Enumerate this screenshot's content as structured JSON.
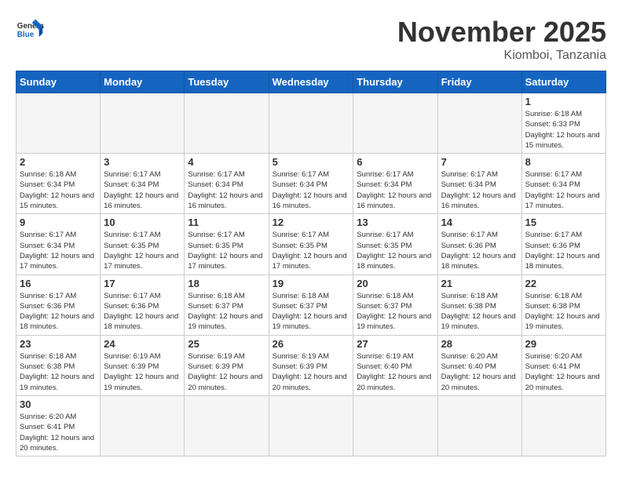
{
  "header": {
    "logo_general": "General",
    "logo_blue": "Blue",
    "month_title": "November 2025",
    "location": "Kiomboi, Tanzania"
  },
  "weekdays": [
    "Sunday",
    "Monday",
    "Tuesday",
    "Wednesday",
    "Thursday",
    "Friday",
    "Saturday"
  ],
  "weeks": [
    [
      {
        "day": "",
        "info": ""
      },
      {
        "day": "",
        "info": ""
      },
      {
        "day": "",
        "info": ""
      },
      {
        "day": "",
        "info": ""
      },
      {
        "day": "",
        "info": ""
      },
      {
        "day": "",
        "info": ""
      },
      {
        "day": "1",
        "info": "Sunrise: 6:18 AM\nSunset: 6:33 PM\nDaylight: 12 hours and 15 minutes."
      }
    ],
    [
      {
        "day": "2",
        "info": "Sunrise: 6:18 AM\nSunset: 6:34 PM\nDaylight: 12 hours and 15 minutes."
      },
      {
        "day": "3",
        "info": "Sunrise: 6:17 AM\nSunset: 6:34 PM\nDaylight: 12 hours and 16 minutes."
      },
      {
        "day": "4",
        "info": "Sunrise: 6:17 AM\nSunset: 6:34 PM\nDaylight: 12 hours and 16 minutes."
      },
      {
        "day": "5",
        "info": "Sunrise: 6:17 AM\nSunset: 6:34 PM\nDaylight: 12 hours and 16 minutes."
      },
      {
        "day": "6",
        "info": "Sunrise: 6:17 AM\nSunset: 6:34 PM\nDaylight: 12 hours and 16 minutes."
      },
      {
        "day": "7",
        "info": "Sunrise: 6:17 AM\nSunset: 6:34 PM\nDaylight: 12 hours and 16 minutes."
      },
      {
        "day": "8",
        "info": "Sunrise: 6:17 AM\nSunset: 6:34 PM\nDaylight: 12 hours and 17 minutes."
      }
    ],
    [
      {
        "day": "9",
        "info": "Sunrise: 6:17 AM\nSunset: 6:34 PM\nDaylight: 12 hours and 17 minutes."
      },
      {
        "day": "10",
        "info": "Sunrise: 6:17 AM\nSunset: 6:35 PM\nDaylight: 12 hours and 17 minutes."
      },
      {
        "day": "11",
        "info": "Sunrise: 6:17 AM\nSunset: 6:35 PM\nDaylight: 12 hours and 17 minutes."
      },
      {
        "day": "12",
        "info": "Sunrise: 6:17 AM\nSunset: 6:35 PM\nDaylight: 12 hours and 17 minutes."
      },
      {
        "day": "13",
        "info": "Sunrise: 6:17 AM\nSunset: 6:35 PM\nDaylight: 12 hours and 18 minutes."
      },
      {
        "day": "14",
        "info": "Sunrise: 6:17 AM\nSunset: 6:36 PM\nDaylight: 12 hours and 18 minutes."
      },
      {
        "day": "15",
        "info": "Sunrise: 6:17 AM\nSunset: 6:36 PM\nDaylight: 12 hours and 18 minutes."
      }
    ],
    [
      {
        "day": "16",
        "info": "Sunrise: 6:17 AM\nSunset: 6:36 PM\nDaylight: 12 hours and 18 minutes."
      },
      {
        "day": "17",
        "info": "Sunrise: 6:17 AM\nSunset: 6:36 PM\nDaylight: 12 hours and 18 minutes."
      },
      {
        "day": "18",
        "info": "Sunrise: 6:18 AM\nSunset: 6:37 PM\nDaylight: 12 hours and 19 minutes."
      },
      {
        "day": "19",
        "info": "Sunrise: 6:18 AM\nSunset: 6:37 PM\nDaylight: 12 hours and 19 minutes."
      },
      {
        "day": "20",
        "info": "Sunrise: 6:18 AM\nSunset: 6:37 PM\nDaylight: 12 hours and 19 minutes."
      },
      {
        "day": "21",
        "info": "Sunrise: 6:18 AM\nSunset: 6:38 PM\nDaylight: 12 hours and 19 minutes."
      },
      {
        "day": "22",
        "info": "Sunrise: 6:18 AM\nSunset: 6:38 PM\nDaylight: 12 hours and 19 minutes."
      }
    ],
    [
      {
        "day": "23",
        "info": "Sunrise: 6:18 AM\nSunset: 6:38 PM\nDaylight: 12 hours and 19 minutes."
      },
      {
        "day": "24",
        "info": "Sunrise: 6:19 AM\nSunset: 6:39 PM\nDaylight: 12 hours and 19 minutes."
      },
      {
        "day": "25",
        "info": "Sunrise: 6:19 AM\nSunset: 6:39 PM\nDaylight: 12 hours and 20 minutes."
      },
      {
        "day": "26",
        "info": "Sunrise: 6:19 AM\nSunset: 6:39 PM\nDaylight: 12 hours and 20 minutes."
      },
      {
        "day": "27",
        "info": "Sunrise: 6:19 AM\nSunset: 6:40 PM\nDaylight: 12 hours and 20 minutes."
      },
      {
        "day": "28",
        "info": "Sunrise: 6:20 AM\nSunset: 6:40 PM\nDaylight: 12 hours and 20 minutes."
      },
      {
        "day": "29",
        "info": "Sunrise: 6:20 AM\nSunset: 6:41 PM\nDaylight: 12 hours and 20 minutes."
      }
    ],
    [
      {
        "day": "30",
        "info": "Sunrise: 6:20 AM\nSunset: 6:41 PM\nDaylight: 12 hours and 20 minutes."
      },
      {
        "day": "",
        "info": ""
      },
      {
        "day": "",
        "info": ""
      },
      {
        "day": "",
        "info": ""
      },
      {
        "day": "",
        "info": ""
      },
      {
        "day": "",
        "info": ""
      },
      {
        "day": "",
        "info": ""
      }
    ]
  ]
}
